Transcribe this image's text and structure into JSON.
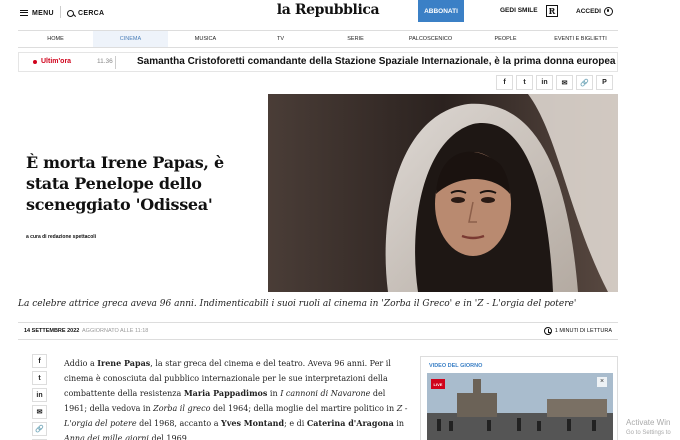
{
  "header": {
    "menu_label": "MENU",
    "search_label": "CERCA",
    "logo": "la Repubblica",
    "subscribe_label": "ABBONATI",
    "gedi_label": "GEDI SMILE",
    "r_badge": "R",
    "login_label": "ACCEDI",
    "brand_color": "#3b80c6"
  },
  "nav": {
    "items": [
      "HOME",
      "CINEMA",
      "MUSICA",
      "TV",
      "SERIE",
      "PALCOSCENICO",
      "PEOPLE",
      "EVENTI E BIGLIETTI"
    ],
    "active": "CINEMA"
  },
  "breaking": {
    "label": "Ultim'ora",
    "time": "11.36",
    "text": "Samantha Cristoforetti comandante della Stazione Spaziale Internazionale, è la prima donna europea"
  },
  "share": {
    "icons": [
      "facebook-icon",
      "twitter-icon",
      "linkedin-icon",
      "email-icon",
      "link-icon",
      "pinterest-icon"
    ],
    "glyphs": [
      "f",
      "t",
      "in",
      "✉",
      "🔗",
      "P"
    ]
  },
  "article": {
    "headline": "È morta Irene Papas, è stata Penelope dello sceneggiato 'Odissea'",
    "byline": "a cura di redazione spettacoli",
    "summary": "La celebre attrice greca aveva 96 anni. Indimenticabili i suoi ruoli al cinema in 'Zorba il Greco' e in 'Z - L'orgia del potere'",
    "date": "14 SETTEMBRE 2022",
    "updated": "AGGIORNATO ALLE 11:18",
    "read_time": "1 MINUTI DI LETTURA",
    "body": [
      {
        "t": "Addio a ",
        "s": ""
      },
      {
        "t": "Irene Papas",
        "s": "b"
      },
      {
        "t": ", la star greca del cinema e del teatro. Aveva 96 anni. Per il cinema è conosciuta dal pubblico internazionale per le sue interpretazioni della combattente della resistenza ",
        "s": ""
      },
      {
        "t": "Maria Pappadimos",
        "s": "b"
      },
      {
        "t": " in ",
        "s": ""
      },
      {
        "t": "I cannoni di Navarone",
        "s": "i"
      },
      {
        "t": " del 1961; della vedova in ",
        "s": ""
      },
      {
        "t": "Zorba il greco",
        "s": "i"
      },
      {
        "t": " del 1964; della moglie del martire politico in ",
        "s": ""
      },
      {
        "t": "Z - L'orgia del potere",
        "s": "i"
      },
      {
        "t": " del 1968, accanto a ",
        "s": ""
      },
      {
        "t": "Yves Montand",
        "s": "b"
      },
      {
        "t": "; e di ",
        "s": ""
      },
      {
        "t": "Caterina d'Aragona",
        "s": "b"
      },
      {
        "t": " in ",
        "s": ""
      },
      {
        "t": "Anna dei mille giorni",
        "s": "i"
      },
      {
        "t": " del 1969.",
        "s": ""
      }
    ]
  },
  "video": {
    "title": "VIDEO DEL GIORNO",
    "live_label": "LIVE"
  },
  "watermark": {
    "line1": "Activate Win",
    "line2": "Go to Settings to"
  }
}
